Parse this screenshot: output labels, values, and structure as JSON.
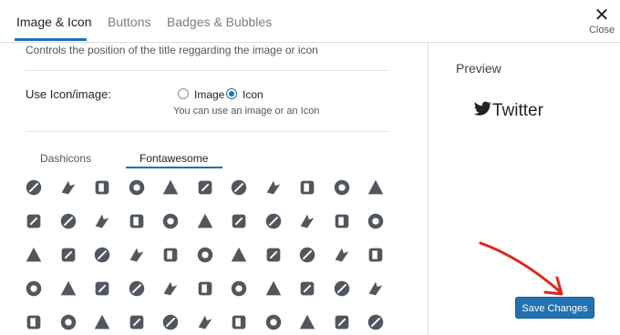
{
  "tabs": [
    "Image & Icon",
    "Buttons",
    "Badges & Bubbles"
  ],
  "close": {
    "label": "Close"
  },
  "settings": {
    "title_position_help": "Controls the position of the title reggarding the image or icon",
    "use_icon_label": "Use Icon/image:",
    "options": [
      "Image",
      "Icon"
    ],
    "selected": "Icon",
    "option_help": "You can use an image or an Icon"
  },
  "icon_tabs": [
    "Dashicons",
    "Fontawesome"
  ],
  "active_icon_tab": "Fontawesome",
  "icons": [
    [
      "first-order-icon",
      "gripfire-icon",
      "pied-piper-alt-icon",
      "product-hunt-icon",
      "page4-icon",
      "pinterest-icon",
      "pinterest-p-icon",
      "pinterest-square-icon",
      "playstation-icon",
      "product-hunt-circle-icon",
      "tron-icon"
    ],
    [
      "python-icon",
      "qq-icon",
      "quinscape-icon",
      "quora-icon",
      "r-project-icon",
      "raspberry-pi-icon",
      "ravelry-icon",
      "react-icon",
      "reacteurope-icon",
      "readme-icon",
      "rebel-icon"
    ],
    [
      "red-river-icon",
      "reddit-icon",
      "reddit-alien-icon",
      "reddit-square-icon",
      "redhat-icon",
      "renren-icon",
      "replyd-icon",
      "researchgate-icon",
      "resolving-icon",
      "rev-icon",
      "rocketchat-icon"
    ],
    [
      "rockrms-icon",
      "rust-icon",
      "safari-icon",
      "salesforce-icon",
      "sass-icon",
      "schlix-icon",
      "scribd-icon",
      "searchengin-icon",
      "sellcast-icon",
      "sellsy-icon",
      "servicestack-icon"
    ],
    [
      "shirtsinbulk-icon",
      "shopify-icon",
      "shopware-icon",
      "simplybuilt-icon",
      "sistrix-icon",
      "sith-icon",
      "sketch-icon",
      "skyatlas-icon",
      "skype-icon",
      "slack-icon",
      "slack-hash-icon"
    ]
  ],
  "preview": {
    "title": "Preview",
    "text": "Twitter",
    "icon": "twitter-icon"
  },
  "save": {
    "label": "Save Changes"
  },
  "colors": {
    "accent": "#2271b1",
    "arrow": "#e0261b",
    "icon": "#50575e"
  }
}
